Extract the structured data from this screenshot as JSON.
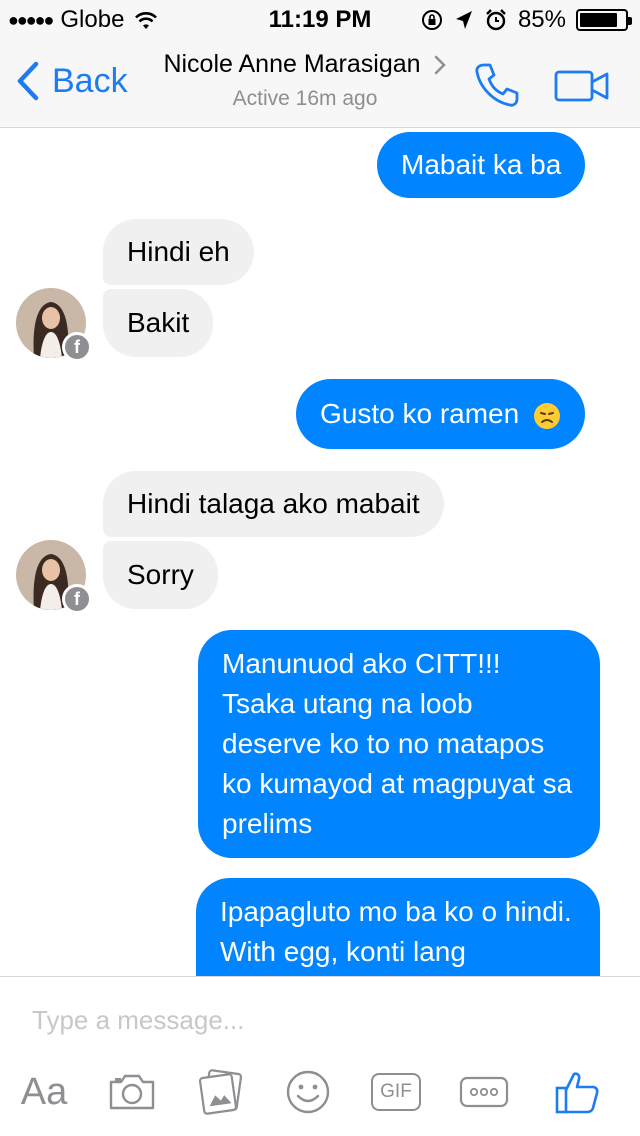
{
  "status_bar": {
    "signal_dots": "●●●●●",
    "carrier": "Globe",
    "time": "11:19 PM",
    "battery_percent": "85%",
    "battery_level": 0.85
  },
  "header": {
    "back_label": "Back",
    "contact_name": "Nicole Anne Marasigan",
    "contact_status": "Active 16m ago",
    "icons": [
      "chevron-left-icon",
      "chevron-right-icon",
      "phone-icon",
      "video-camera-icon"
    ]
  },
  "messages": [
    {
      "from": "me",
      "text": "Mabait ka ba"
    },
    {
      "from": "them",
      "text": "Hindi eh"
    },
    {
      "from": "them",
      "text": "Bakit"
    },
    {
      "from": "me",
      "text": "Gusto ko ramen",
      "emoji": "disappointed-face"
    },
    {
      "from": "them",
      "text": "Hindi talaga ako mabait"
    },
    {
      "from": "them",
      "text": "Sorry"
    },
    {
      "from": "me",
      "text": "Manunuod ako CITT!!! Tsaka utang na loob deserve ko to no matapos ko kumayod at magpuyat sa prelims"
    },
    {
      "from": "me",
      "text": "Ipapagluto mo ba ko o hindi. With egg, konti lang"
    }
  ],
  "composer": {
    "placeholder": "Type a message...",
    "aa_label": "Aa",
    "gif_label": "GIF",
    "tools": [
      "text-format-icon",
      "camera-icon",
      "photo-gallery-icon",
      "smiley-icon",
      "gif-icon",
      "more-icon",
      "thumbs-up-icon"
    ]
  },
  "colors": {
    "accent": "#0084ff",
    "ios_blue": "#1d7cf2",
    "incoming_bubble": "#f1f0f0",
    "muted": "#8e8e93"
  }
}
